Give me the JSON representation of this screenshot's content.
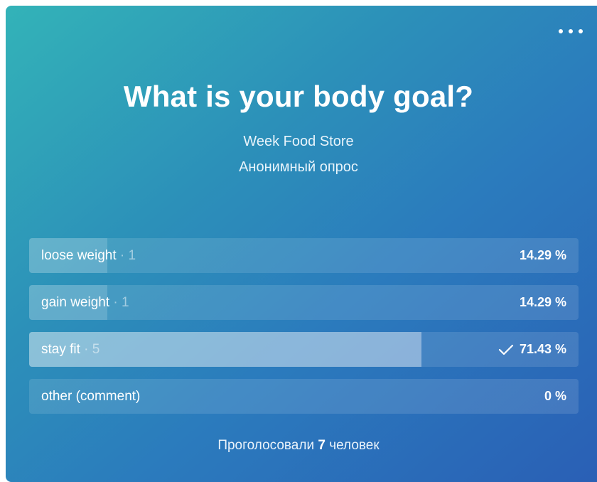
{
  "poll": {
    "title": "What is your body goal?",
    "author": "Week Food Store",
    "poll_type": "Анонимный опрос",
    "options": [
      {
        "label": "loose weight",
        "count_text": " · 1",
        "percent_text": "14.29 %",
        "share": 0.1429,
        "voted": false
      },
      {
        "label": "gain weight",
        "count_text": " · 1",
        "percent_text": "14.29 %",
        "share": 0.1429,
        "voted": false
      },
      {
        "label": "stay fit",
        "count_text": " · 5",
        "percent_text": "71.43 %",
        "share": 0.7143,
        "voted": true
      },
      {
        "label": "other (comment)",
        "count_text": "",
        "percent_text": "0 %",
        "share": 0,
        "voted": false
      }
    ],
    "footer_prefix": "Проголосовали ",
    "footer_count": "7",
    "footer_suffix": " человек"
  },
  "icons": {
    "more": "more-horizontal-icon",
    "check": "check-icon"
  },
  "colors": {
    "gradient_start": "#33b3b8",
    "gradient_end": "#2a5fb5",
    "text": "#ffffff"
  }
}
